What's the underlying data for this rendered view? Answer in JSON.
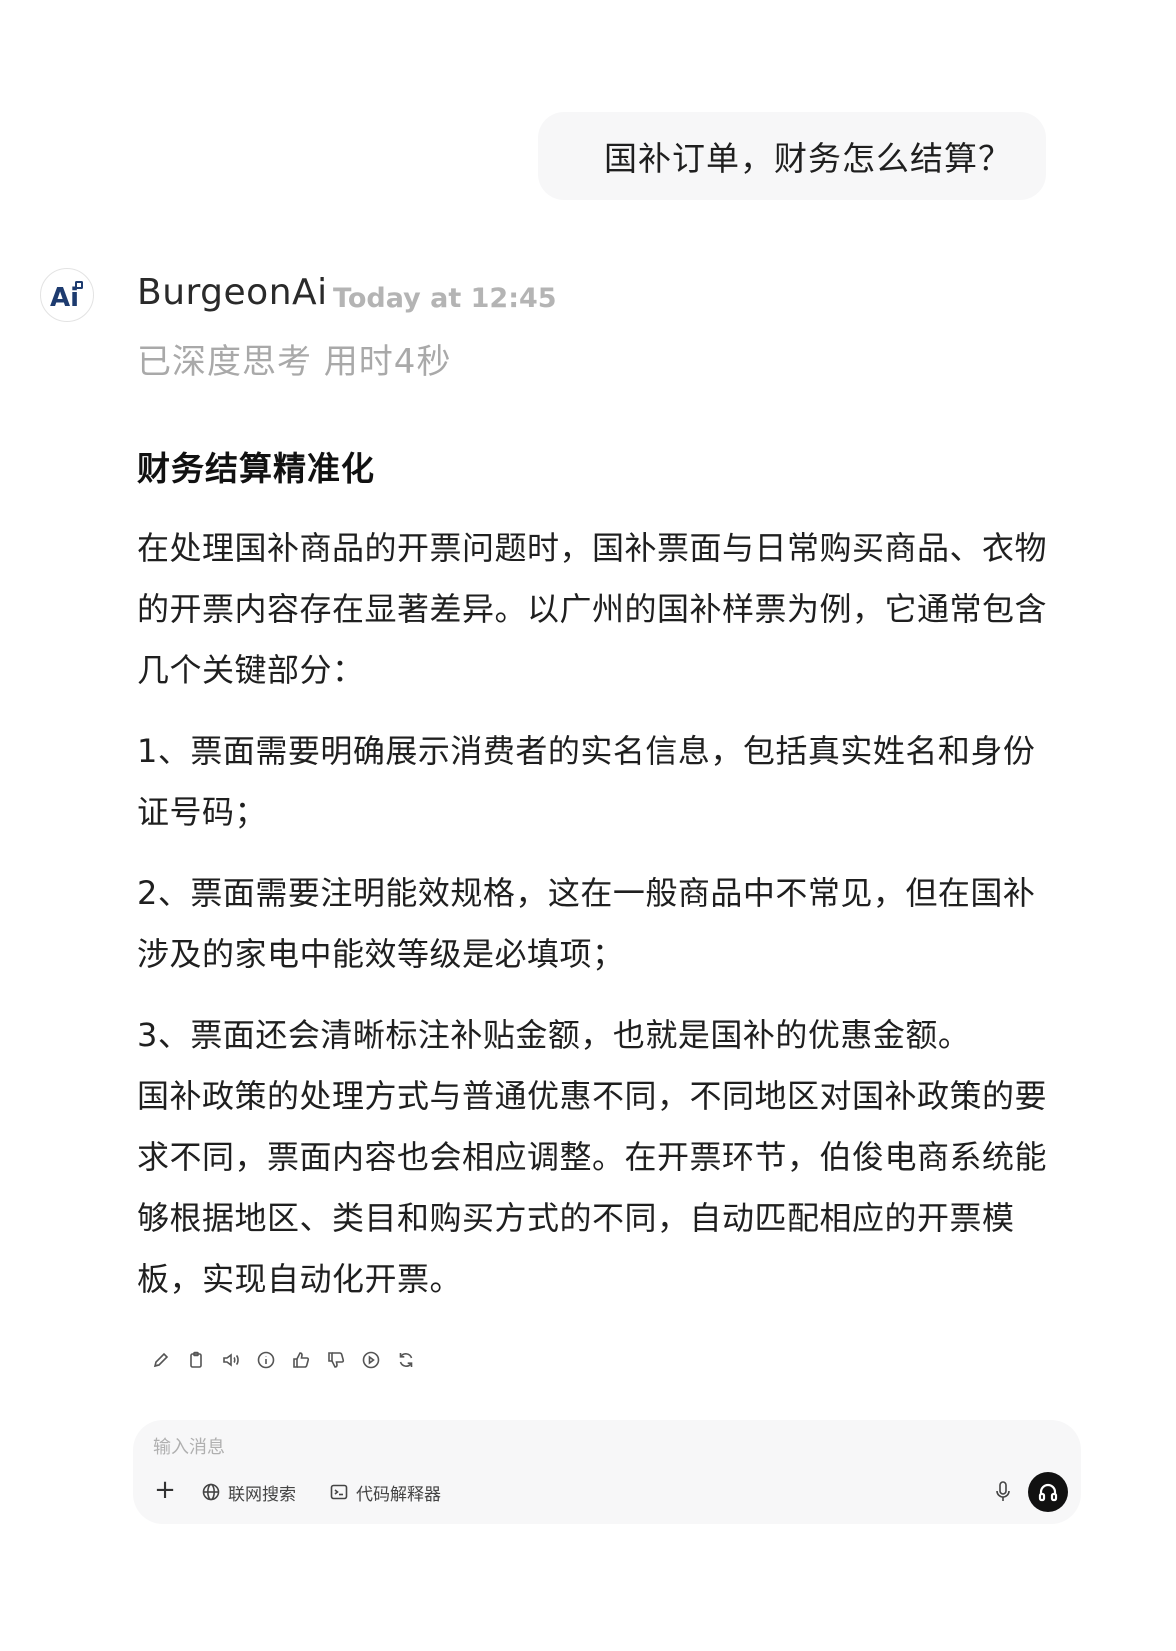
{
  "user_message": "国补订单，财务怎么结算？",
  "assistant": {
    "name": "BurgeonAi",
    "timestamp": "Today at 12:45",
    "thinking_status": "已深度思考 用时4秒",
    "avatar_text": "Ai",
    "heading": "财务结算精准化",
    "paragraphs": [
      "在处理国补商品的开票问题时，国补票面与日常购买商品、衣物的开票内容存在显著差异。以广州的国补样票为例，它通常包含几个关键部分：",
      "1、票面需要明确展示消费者的实名信息，包括真实姓名和身份证号码；",
      "2、票面需要注明能效规格，这在一般商品中不常见，但在国补涉及的家电中能效等级是必填项；",
      "3、票面还会清晰标注补贴金额，也就是国补的优惠金额。",
      "国补政策的处理方式与普通优惠不同，不同地区对国补政策的要求不同，票面内容也会相应调整。在开票环节，伯俊电商系统能够根据地区、类目和购买方式的不同，自动匹配相应的开票模板，实现自动化开票。"
    ],
    "actions": [
      "edit-icon",
      "copy-icon",
      "speaker-icon",
      "info-icon",
      "thumbs-up-icon",
      "thumbs-down-icon",
      "play-icon",
      "regenerate-icon"
    ]
  },
  "composer": {
    "placeholder": "输入消息",
    "web_search_label": "联网搜索",
    "code_interpreter_label": "代码解释器"
  },
  "colors": {
    "bubble_bg": "#f7f7f8",
    "muted_text": "#a9a9a9",
    "avatar_brand": "#1d3b6f"
  }
}
